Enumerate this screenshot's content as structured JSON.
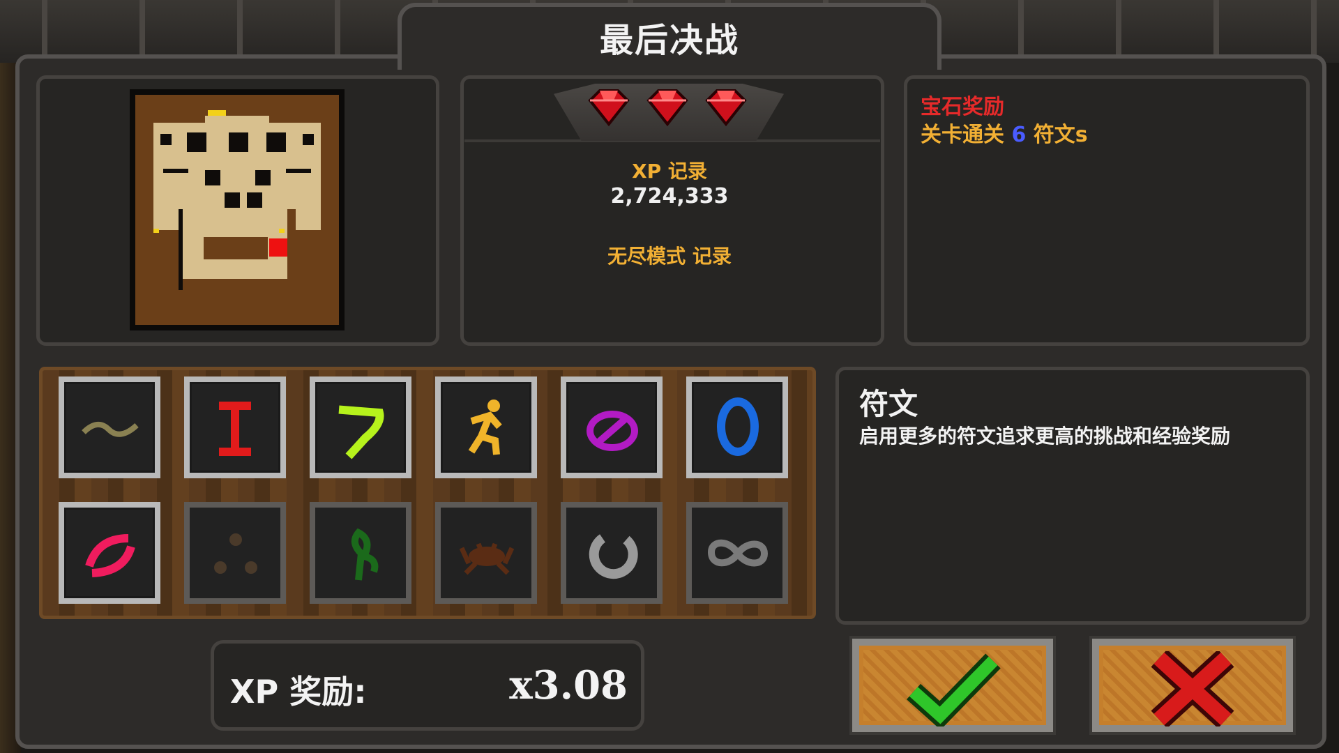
{
  "title": "最后决战",
  "record": {
    "xp_label": "XP 记录",
    "xp_value": "2,724,333",
    "endless_label": "无尽模式 记录"
  },
  "reward": {
    "title": "宝石奖励",
    "line_prefix": "关卡通关",
    "rune_count": "6",
    "line_suffix": "符文s"
  },
  "rune_info": {
    "title": "符文",
    "description": "启用更多的符文追求更高的挑战和经验奖励"
  },
  "xp_bonus": {
    "label": "XP 奖励:",
    "value": "x3.08"
  },
  "gems": [
    {
      "name": "ruby-gem-icon",
      "color": "#d0101c"
    },
    {
      "name": "ruby-gem-icon",
      "color": "#d0101c"
    },
    {
      "name": "ruby-gem-icon",
      "color": "#d0101c"
    }
  ],
  "runes": [
    {
      "icon": "wave-rune-icon",
      "active": true,
      "color": "#8a8152"
    },
    {
      "icon": "i-beam-rune-icon",
      "active": true,
      "color": "#e21b1b"
    },
    {
      "icon": "hook-rune-icon",
      "active": true,
      "color": "#b6f21c"
    },
    {
      "icon": "runner-rune-icon",
      "active": true,
      "color": "#f0b42a"
    },
    {
      "icon": "prohibited-rune-icon",
      "active": true,
      "color": "#b21bc4"
    },
    {
      "icon": "ring-rune-icon",
      "active": true,
      "color": "#1a6ae0"
    },
    {
      "icon": "slash-ring-rune-icon",
      "active": true,
      "color": "#f01c5e"
    },
    {
      "icon": "three-dots-rune-icon",
      "active": false,
      "color": "#4a3a2a"
    },
    {
      "icon": "sprout-rune-icon",
      "active": false,
      "color": "#1b6a1b"
    },
    {
      "icon": "crab-rune-icon",
      "active": false,
      "color": "#5a2c14"
    },
    {
      "icon": "crescent-rune-icon",
      "active": false,
      "color": "#9a9a9a"
    },
    {
      "icon": "infinity-rune-icon",
      "active": false,
      "color": "#7a7a7a"
    }
  ],
  "buttons": {
    "confirm": {
      "icon": "checkmark-icon",
      "color": "#2fc62a"
    },
    "cancel": {
      "icon": "cross-icon",
      "color": "#d81b1b"
    }
  }
}
